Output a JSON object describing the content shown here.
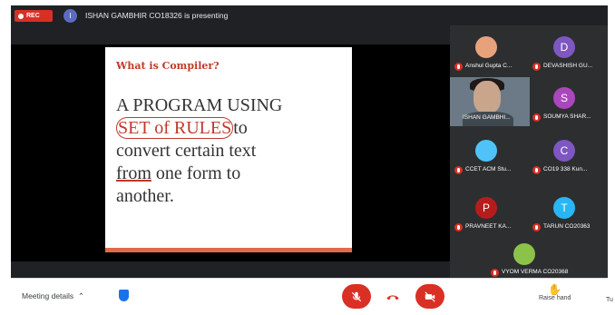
{
  "recording": {
    "label": "REC"
  },
  "presenter": {
    "initial": "I",
    "text": "ISHAN GAMBHIR CO18326 is presenting"
  },
  "slide": {
    "title": "What is Compiler?",
    "lines": [
      "A PROGRAM USING",
      "SET of RULES",
      "to",
      "convert certain text",
      "from",
      " one form to",
      "another."
    ]
  },
  "participants": [
    {
      "initial": "",
      "name": "Anshul Gupta C...",
      "color": "#e8a27b"
    },
    {
      "initial": "D",
      "name": "DEVASHISH GU...",
      "color": "#7e57c2"
    },
    {
      "initial": "",
      "name": "ISHAN GAMBHI...",
      "color": "#6b7a86"
    },
    {
      "initial": "S",
      "name": "SOUMYA SHAR...",
      "color": "#ab47bc"
    },
    {
      "initial": "",
      "name": "CCET ACM Stu...",
      "color": "#4fc3f7"
    },
    {
      "initial": "C",
      "name": "CO19 338 Kun...",
      "color": "#7e57c2"
    },
    {
      "initial": "P",
      "name": "PRAVNEET KA...",
      "color": "#b71c1c"
    },
    {
      "initial": "T",
      "name": "TARUN CO20363",
      "color": "#29b6f6"
    },
    {
      "initial": "",
      "name": "VYOM VERMA CO20368",
      "color": "#8bc34a"
    }
  ],
  "controls": {
    "meeting_details": "Meeting details",
    "raise_hand": "Raise hand",
    "more_label": "Tu"
  }
}
